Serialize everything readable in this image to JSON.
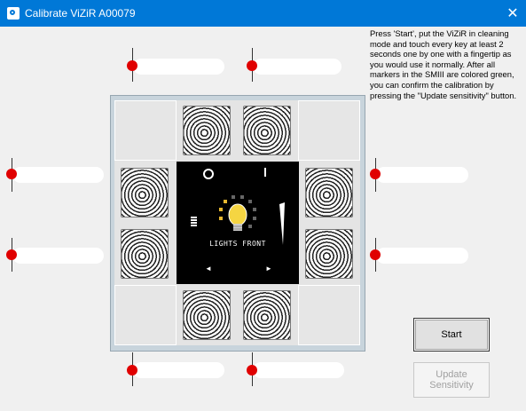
{
  "window": {
    "title": "Calibrate ViZiR A00079",
    "close_glyph": "✕",
    "accent": "#0078d7"
  },
  "instructions": "Press 'Start', put the ViZiR in cleaning mode and touch every key at least 2 seconds one by one with a fingertip as you would use it normally. After all markers in the SMIII are colored green, you can confirm the calibration by pressing the \"Update sensitivity\" button.",
  "device_screen": {
    "label": "LIGHTS FRONT",
    "left_arrow": "◄",
    "right_arrow": "►"
  },
  "buttons": {
    "start": "Start",
    "update": "Update Sensitivity",
    "update_enabled": false
  },
  "marker_color": "#e00000"
}
